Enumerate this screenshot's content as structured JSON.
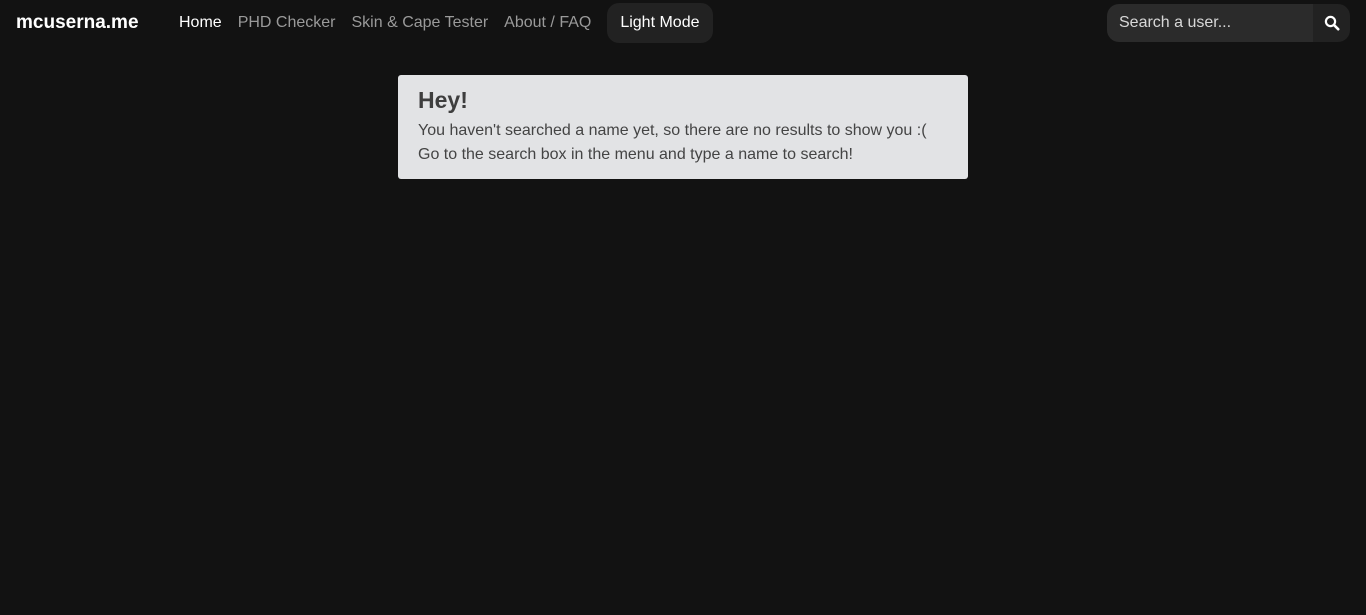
{
  "brand": {
    "name": "mcuserna.me"
  },
  "nav": {
    "items": [
      {
        "label": "Home",
        "active": true
      },
      {
        "label": "PHD Checker",
        "active": false
      },
      {
        "label": "Skin & Cape Tester",
        "active": false
      },
      {
        "label": "About / FAQ",
        "active": false
      }
    ],
    "mode_toggle_label": "Light Mode"
  },
  "search": {
    "placeholder": "Search a user...",
    "value": "",
    "button_icon": "search-icon"
  },
  "alert": {
    "title": "Hey!",
    "line1": "You haven't searched a name yet, so there are no results to show you :(",
    "line2": "Go to the search box in the menu and type a name to search!"
  },
  "colors": {
    "background": "#121212",
    "nav_active": "#ffffff",
    "nav_inactive": "#9a9a9a",
    "alert_background": "#e2e3e5",
    "button_background": "#222222"
  }
}
